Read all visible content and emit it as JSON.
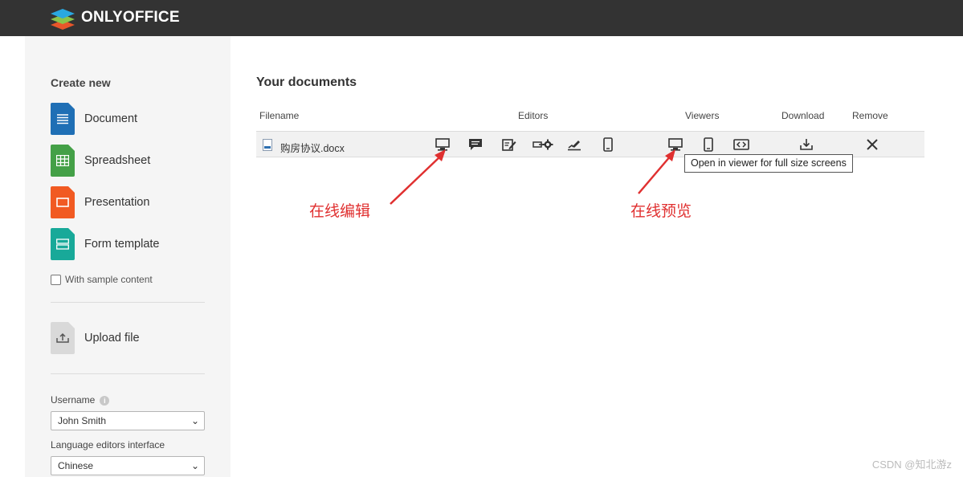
{
  "header": {
    "brand": "ONLYOFFICE",
    "logo_icon": "onlyoffice-logo-icon",
    "background": "#333333"
  },
  "sidebar": {
    "title": "Create new",
    "items": [
      {
        "label": "Document",
        "icon": "document-icon",
        "color": "#1f6fb5"
      },
      {
        "label": "Spreadsheet",
        "icon": "spreadsheet-icon",
        "color": "#44a047"
      },
      {
        "label": "Presentation",
        "icon": "presentation-icon",
        "color": "#f15a22"
      },
      {
        "label": "Form template",
        "icon": "form-template-icon",
        "color": "#18a999"
      }
    ],
    "sample_label": "With sample content",
    "upload_label": "Upload file",
    "username_label": "Username",
    "username_value": "John Smith",
    "language_label": "Language editors interface",
    "language_value": "Chinese"
  },
  "main": {
    "title": "Your documents",
    "columns": {
      "filename": "Filename",
      "editors": "Editors",
      "viewers": "Viewers",
      "download": "Download",
      "remove": "Remove"
    },
    "files": [
      {
        "name": "购房协议.docx"
      }
    ],
    "tooltip": "Open in viewer for full size screens"
  },
  "annotations": {
    "edit": "在线编辑",
    "preview": "在线预览",
    "color": "#e03030"
  },
  "watermark": "CSDN @知北游z"
}
